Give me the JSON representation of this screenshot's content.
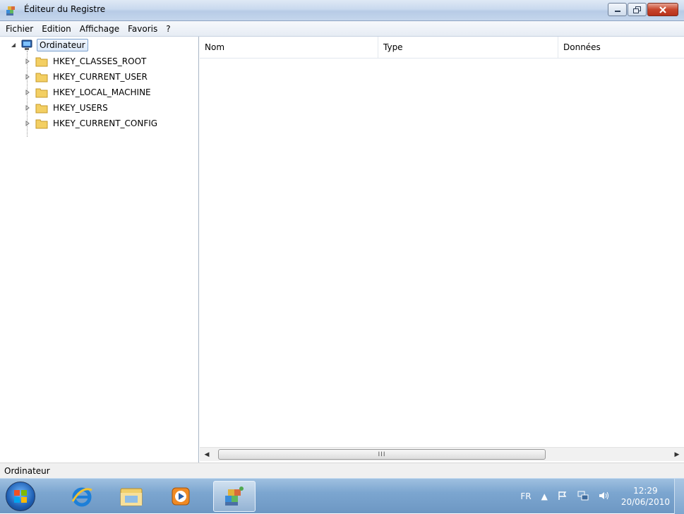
{
  "window": {
    "title": "Éditeur du Registre",
    "icons": {
      "app": "registry-editor-icon",
      "minimize": "minimize-icon",
      "restore": "restore-icon",
      "close": "close-icon"
    }
  },
  "menu": [
    "Fichier",
    "Edition",
    "Affichage",
    "Favoris",
    "?"
  ],
  "tree": {
    "root": "Ordinateur",
    "keys": [
      "HKEY_CLASSES_ROOT",
      "HKEY_CURRENT_USER",
      "HKEY_LOCAL_MACHINE",
      "HKEY_USERS",
      "HKEY_CURRENT_CONFIG"
    ]
  },
  "list": {
    "columns": [
      "Nom",
      "Type",
      "Données"
    ],
    "scroll_grip": "III"
  },
  "status": {
    "text": "Ordinateur"
  },
  "taskbar": {
    "apps": [
      "internet-explorer-icon",
      "file-explorer-icon",
      "media-player-icon",
      "registry-editor-icon"
    ],
    "tray": {
      "language": "FR",
      "time": "12:29",
      "date": "20/06/2010"
    }
  },
  "colors": {
    "accent": "#6d97c3",
    "selection": "#dbe8f8",
    "close": "#c7452c"
  }
}
